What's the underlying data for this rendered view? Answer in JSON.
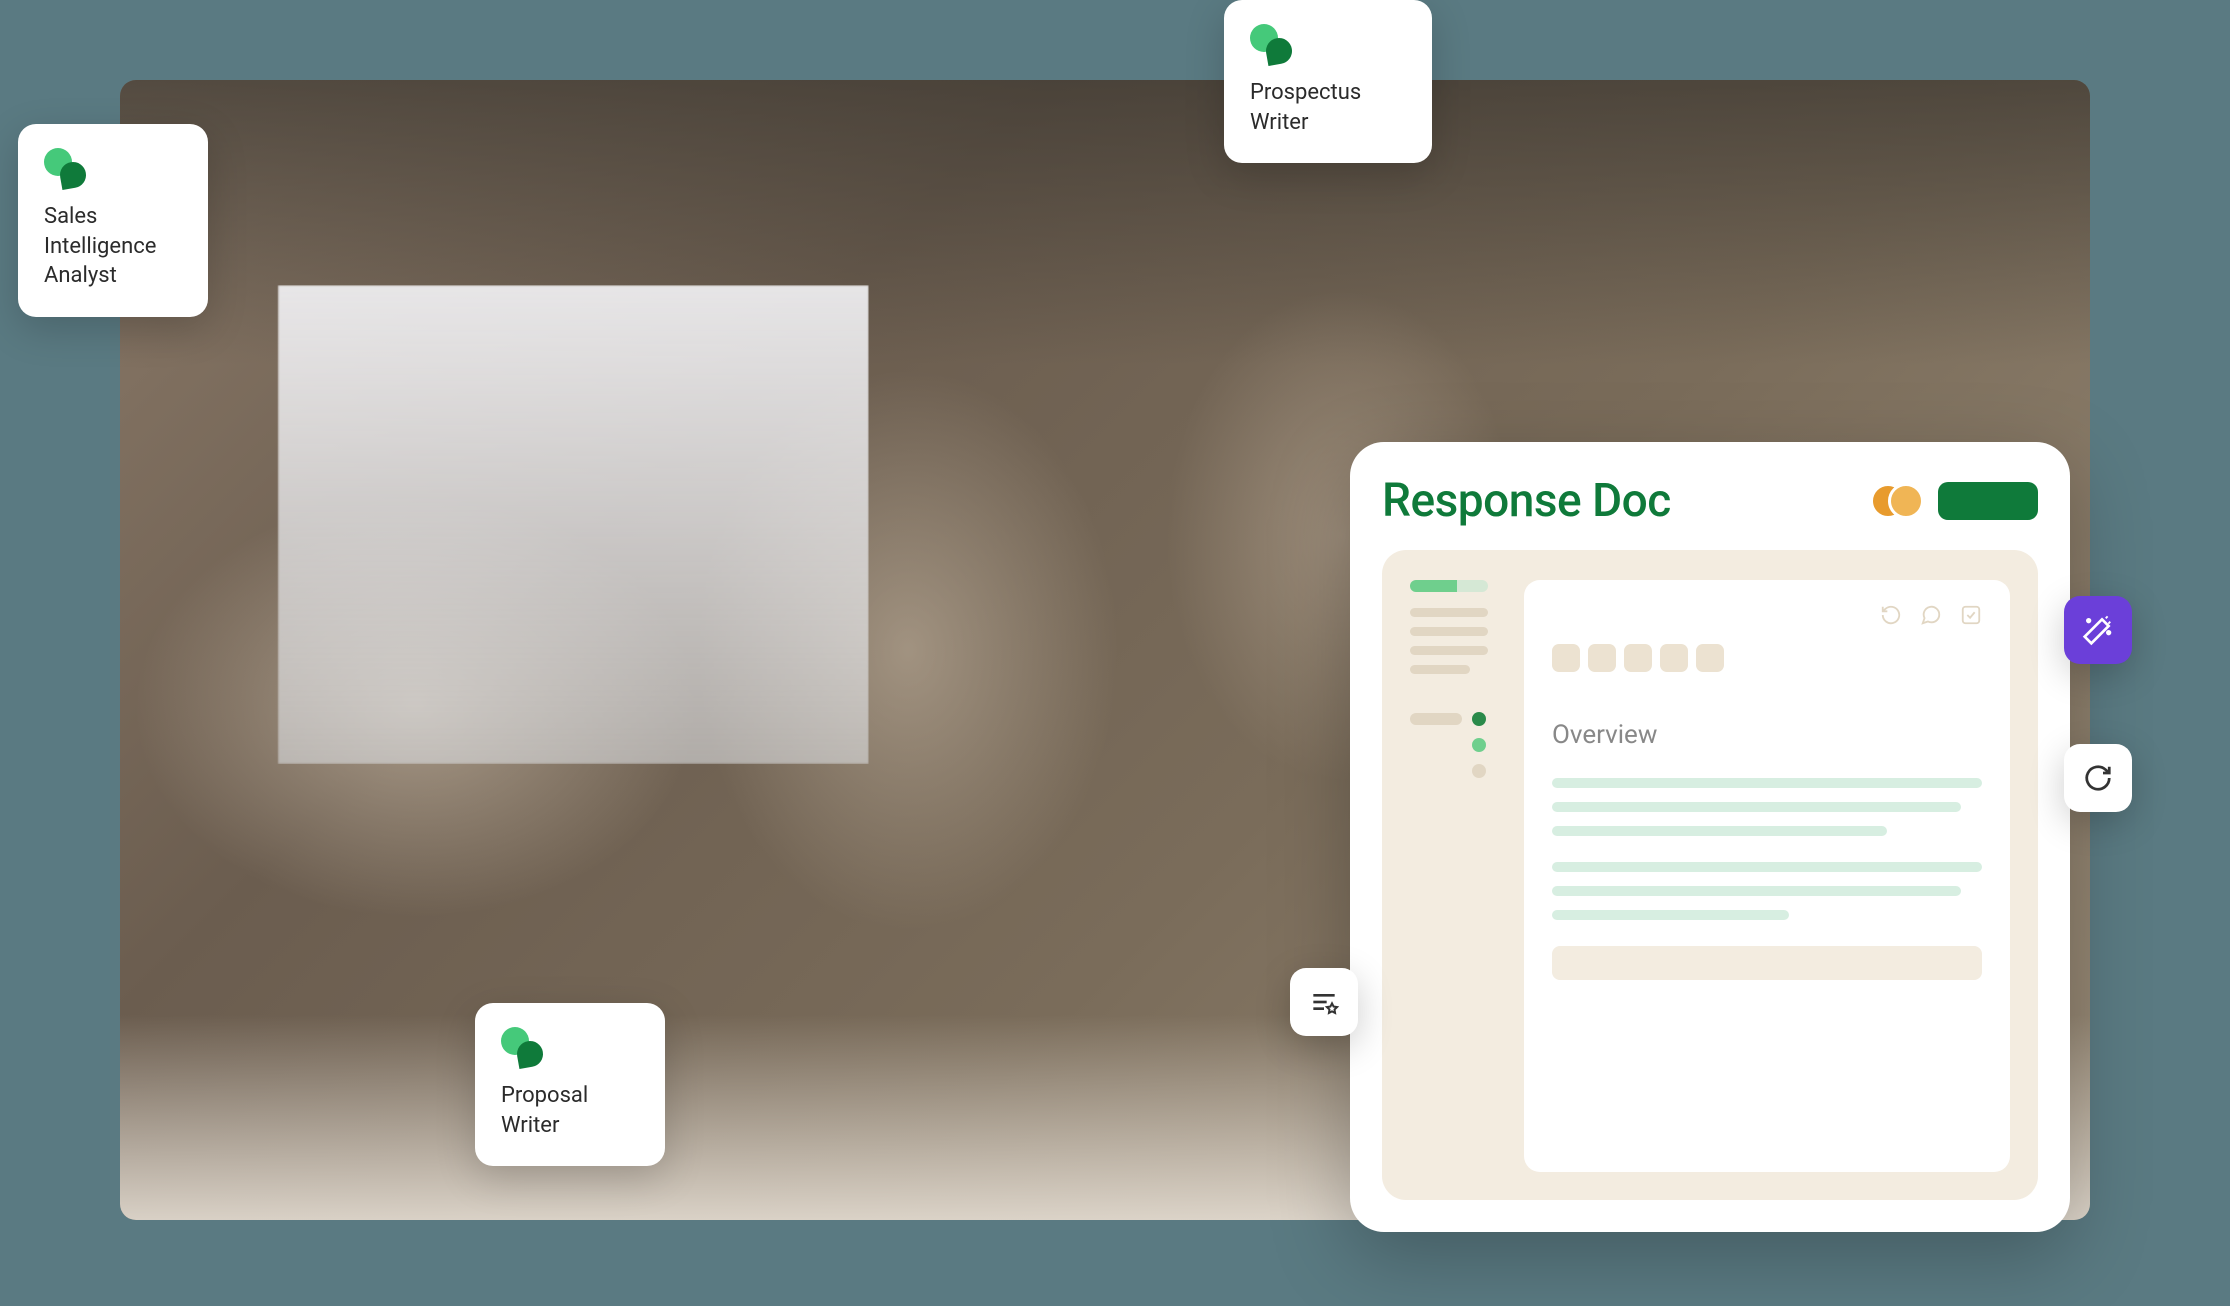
{
  "tools": {
    "sales": {
      "label": "Sales\nIntelligence\nAnalyst"
    },
    "prospectus": {
      "label": "Prospectus\nWriter"
    },
    "proposal": {
      "label": "Proposal\nWriter"
    }
  },
  "doc": {
    "title": "Response Doc",
    "page": {
      "section_title": "Overview"
    }
  },
  "colors": {
    "brand_green": "#0f7a3a",
    "accent_green": "#45c97a",
    "purple": "#6b3fd9",
    "beige": "#f3ece0"
  },
  "icons": {
    "magic": "magic-wand-icon",
    "refresh": "refresh-icon",
    "list": "list-starred-icon",
    "undo": "undo-icon",
    "comment": "comment-icon",
    "check": "checkbox-icon"
  }
}
